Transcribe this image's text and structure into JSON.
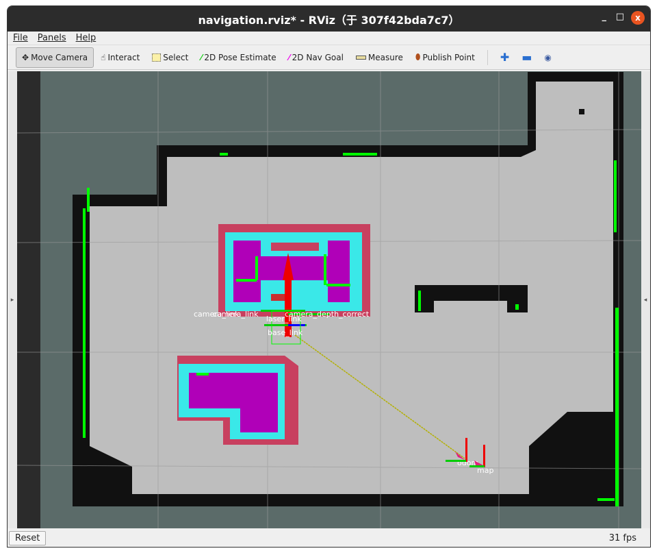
{
  "window": {
    "title": "navigation.rviz* - RViz（于 307f42bda7c7）",
    "minimize": "_",
    "maximize": "□",
    "close": "x"
  },
  "menu": [
    "File",
    "Panels",
    "Help"
  ],
  "toolbar": [
    {
      "label": "Move Camera",
      "icon": "move-camera-icon",
      "active": true
    },
    {
      "label": "Interact",
      "icon": "hand-icon"
    },
    {
      "label": "Select",
      "icon": "select-icon"
    },
    {
      "label": "2D Pose Estimate",
      "icon": "green-arrow-icon"
    },
    {
      "label": "2D Nav Goal",
      "icon": "magenta-arrow-icon"
    },
    {
      "label": "Measure",
      "icon": "ruler-icon"
    },
    {
      "label": "Publish Point",
      "icon": "map-pin-icon"
    }
  ],
  "view_tools": [
    "plus-icon",
    "minus-icon",
    "eye-icon"
  ],
  "frames": {
    "camera": "camera_link",
    "correct": "camera_depth_correct",
    "base_link": "base_link",
    "laser_link": "laser_link",
    "odom": "odom",
    "map": "map"
  },
  "colors": {
    "free": "#bebebe",
    "occupied": "#111111",
    "unknown": "#5b6b69",
    "inflation": "#c8405f",
    "cyan": "#3ae8e8",
    "lethal": "#b000b8",
    "laser": "#00ff00"
  },
  "status": {
    "reset": "Reset",
    "fps": "31 fps"
  }
}
